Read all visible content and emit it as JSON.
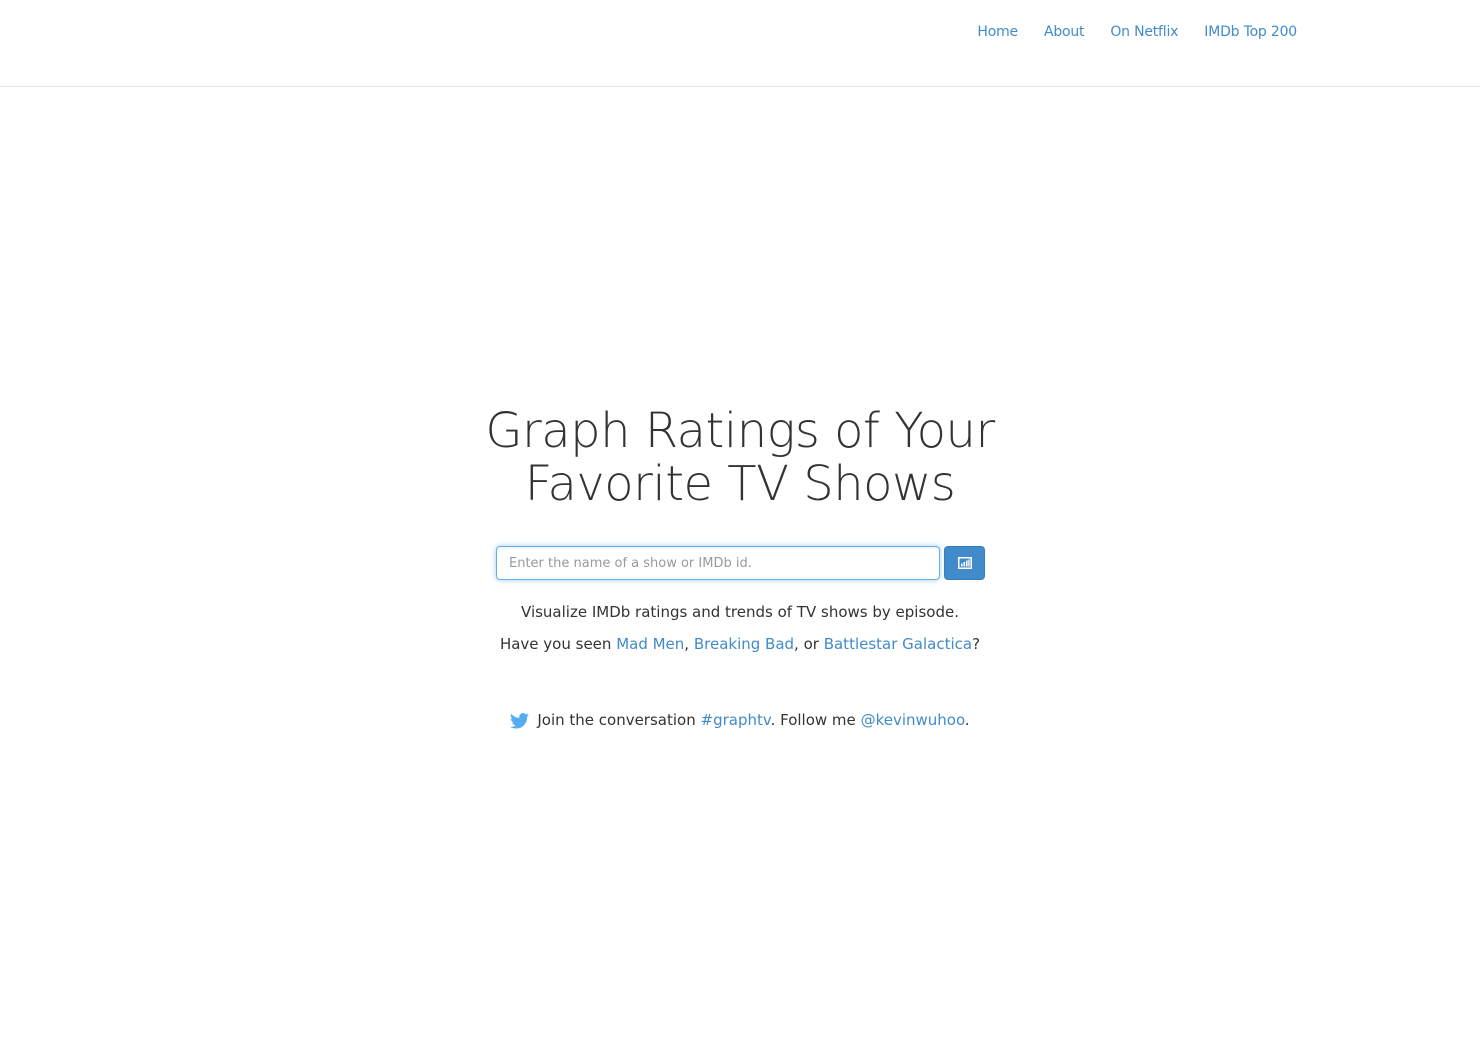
{
  "nav": {
    "items": [
      {
        "label": "Home"
      },
      {
        "label": "About"
      },
      {
        "label": "On Netflix"
      },
      {
        "label": "IMDb Top 200"
      }
    ]
  },
  "hero": {
    "title": "Graph Ratings of Your Favorite TV Shows"
  },
  "search": {
    "placeholder": "Enter the name of a show or IMDb id.",
    "value": "",
    "button_icon": "bar-chart-icon"
  },
  "tagline": "Visualize IMDb ratings and trends of TV shows by episode.",
  "suggestions": {
    "prefix": "Have you seen ",
    "shows": [
      {
        "label": "Mad Men"
      },
      {
        "label": "Breaking Bad"
      },
      {
        "label": "Battlestar Galactica"
      }
    ],
    "sep1": ", ",
    "sep2": ", or ",
    "suffix": "?"
  },
  "social": {
    "icon": "twitter-icon",
    "join_text": "Join the conversation",
    "hashtag": "#graphtv",
    "follow_text": ". Follow me",
    "handle": "@kevinwuhoo",
    "end": "."
  },
  "colors": {
    "link": "#428bca",
    "button": "#428bca",
    "text": "#333333",
    "twitter": "#55acee"
  }
}
